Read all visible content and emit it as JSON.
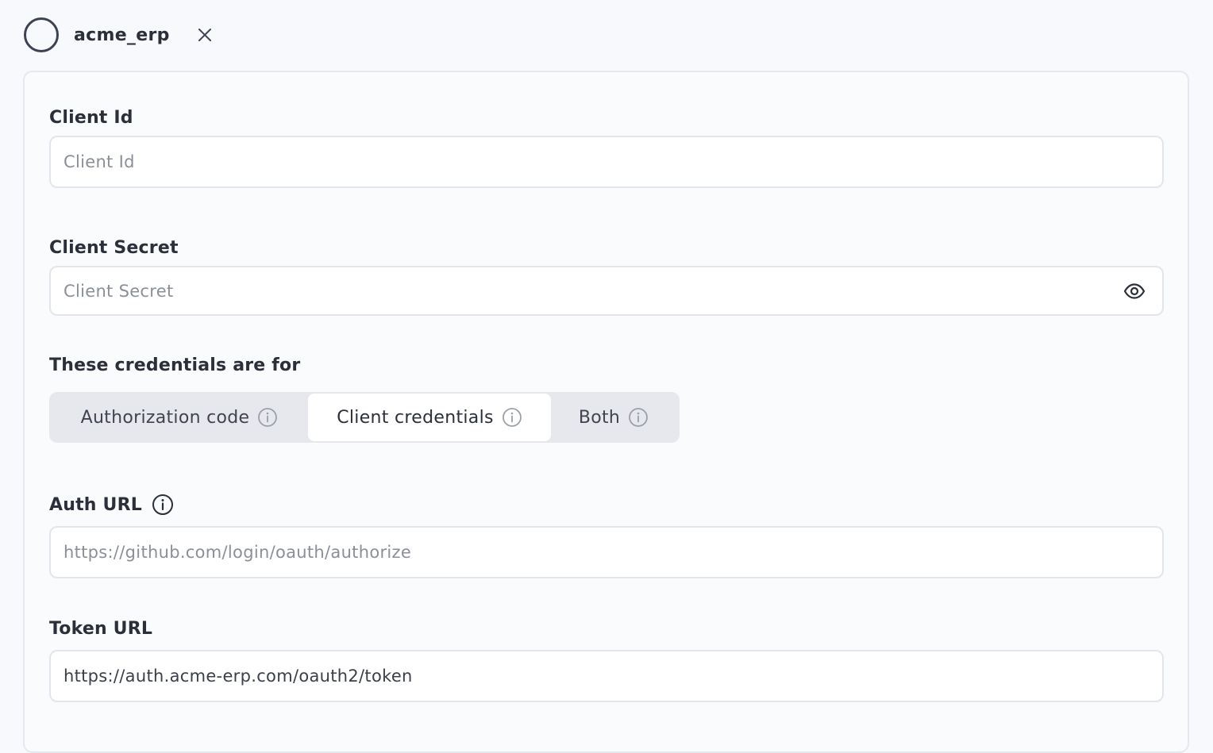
{
  "header": {
    "title": "acme_erp"
  },
  "form": {
    "client_id": {
      "label": "Client Id",
      "placeholder": "Client Id",
      "value": ""
    },
    "client_secret": {
      "label": "Client Secret",
      "placeholder": "Client Secret",
      "value": ""
    },
    "credentials_for": {
      "label": "These credentials are for",
      "options": [
        {
          "label": "Authorization code",
          "selected": false
        },
        {
          "label": "Client credentials",
          "selected": true
        },
        {
          "label": "Both",
          "selected": false
        }
      ]
    },
    "auth_url": {
      "label": "Auth URL",
      "placeholder": "https://github.com/login/oauth/authorize",
      "value": ""
    },
    "token_url": {
      "label": "Token URL",
      "placeholder": "",
      "value": "https://auth.acme-erp.com/oauth2/token"
    }
  },
  "icons": {
    "status": "status-ring-icon",
    "close": "close-icon",
    "reveal": "eye-icon",
    "info": "info-icon"
  }
}
